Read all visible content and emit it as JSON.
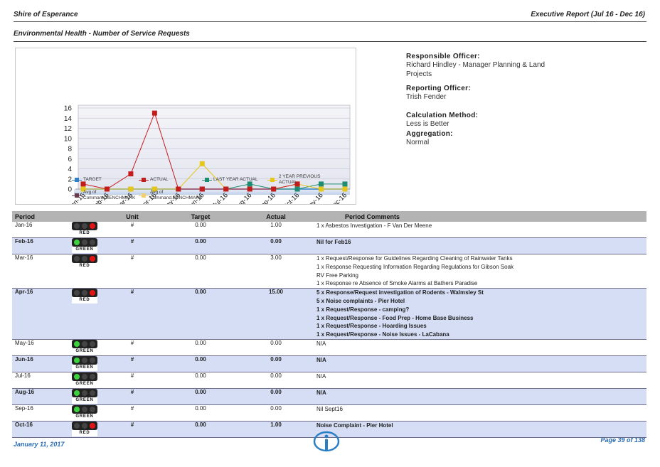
{
  "header": {
    "organisation": "Shire of Esperance",
    "report": "Executive Report (Jul 16 - Dec 16)",
    "subtitle": "Environmental Health - Number of Service Requests"
  },
  "chart_data": {
    "type": "line",
    "categories": [
      "Jan-16",
      "Feb-16",
      "Mar-16",
      "Apr-16",
      "May-16",
      "Jun-16",
      "Jul-16",
      "Aug-16",
      "Sep-16",
      "Oct-16",
      "Nov-16",
      "Dec-16"
    ],
    "ylim": [
      0,
      16
    ],
    "yticks": [
      "0",
      "2",
      "4",
      "6",
      "8",
      "10",
      "12",
      "14",
      "16"
    ],
    "grid": true,
    "legend_position": "bottom",
    "series": [
      {
        "name": "TARGET",
        "color": "#2f7fc9",
        "values": [
          0,
          0,
          0,
          0,
          0,
          0,
          0,
          0,
          0,
          0,
          0,
          0
        ]
      },
      {
        "name": "ACTUAL",
        "color": "#c41b1b",
        "values": [
          1,
          0,
          3,
          15,
          0,
          0,
          0,
          0,
          0,
          1,
          null,
          null
        ]
      },
      {
        "name": "LAST YEAR ACTUAL",
        "color": "#1e8c6e",
        "values": [
          0,
          0,
          0,
          0,
          0,
          0,
          0,
          1,
          0,
          0,
          1,
          1
        ]
      },
      {
        "name": "2 YEAR PREVIOUS ACTUAL",
        "color": "#e6c619",
        "values": [
          0,
          0,
          0,
          0,
          0,
          5,
          0,
          0,
          0,
          1,
          0,
          0
        ]
      },
      {
        "name": "Avg of Command.BENCHMARK",
        "color": "#6b3a4a",
        "values": []
      },
      {
        "name": "Avg of Command.BENCHMARK",
        "color": "#f0d06e",
        "values": []
      }
    ]
  },
  "legend": [
    {
      "label": "TARGET",
      "color": "#2f7fc9"
    },
    {
      "label": "ACTUAL",
      "color": "#c41b1b"
    },
    {
      "label": "LAST YEAR ACTUAL",
      "color": "#1e8c6e"
    },
    {
      "label": "2 YEAR PREVIOUS ACTUAL",
      "color": "#e6c619"
    },
    {
      "label": "Avg of Command.BENCHMARK",
      "color": "#6b3a4a"
    },
    {
      "label": "Avg of Command.BENCHMARK",
      "color": "#f0d06e"
    }
  ],
  "info": {
    "responsible_label": "Responsible Officer:",
    "responsible_value": "Richard Hindley - Manager Planning & Land Projects",
    "reporting_label": "Reporting Officer:",
    "reporting_value": "Trish Fender",
    "calc_label": "Calculation Method:",
    "calc_value": "Less is Better",
    "agg_label": "Aggregation:",
    "agg_value": "Normal"
  },
  "table": {
    "headers": {
      "period": "Period",
      "unit": "Unit",
      "target": "Target",
      "actual": "Actual",
      "comments": "Period Comments"
    },
    "rows": [
      {
        "period": "Jan-16",
        "status": "RED",
        "unit": "#",
        "target": "0.00",
        "actual": "1.00",
        "comments": [
          "1 x Asbestos Investigation - F Van Der Meene"
        ]
      },
      {
        "period": "Feb-16",
        "status": "GREEN",
        "unit": "#",
        "target": "0.00",
        "actual": "0.00",
        "comments": [
          "Nil for Feb16"
        ]
      },
      {
        "period": "Mar-16",
        "status": "RED",
        "unit": "#",
        "target": "0.00",
        "actual": "3.00",
        "comments": [
          "1 x Request/Response for Guidelines Regarding Cleaning of Rainwater Tanks",
          "1 x Response Requesting Information Regarding Regulations for Gibson Soak",
          "RV Free Parking",
          "1 x Response re Absence of Smoke Alarms at Bathers Paradise"
        ]
      },
      {
        "period": "Apr-16",
        "status": "RED",
        "unit": "#",
        "target": "0.00",
        "actual": "15.00",
        "comments": [
          "5 x Response/Request investigation of Rodents - Walmsley St",
          "5 x Noise complaints - Pier Hotel",
          "1 x Request/Response - camping?",
          "1 x Request/Response - Food Prep - Home Base Business",
          "1 x Request/Response - Hoarding Issues",
          "1 x Request/Response - Noise Issues - LaCabana"
        ]
      },
      {
        "period": "May-16",
        "status": "GREEN",
        "unit": "#",
        "target": "0.00",
        "actual": "0.00",
        "comments": [
          "N/A"
        ]
      },
      {
        "period": "Jun-16",
        "status": "GREEN",
        "unit": "#",
        "target": "0.00",
        "actual": "0.00",
        "comments": [
          "N/A"
        ]
      },
      {
        "period": "Jul-16",
        "status": "GREEN",
        "unit": "#",
        "target": "0.00",
        "actual": "0.00",
        "comments": [
          "N/A"
        ]
      },
      {
        "period": "Aug-16",
        "status": "GREEN",
        "unit": "#",
        "target": "0.00",
        "actual": "0.00",
        "comments": [
          "N/A"
        ]
      },
      {
        "period": "Sep-16",
        "status": "GREEN",
        "unit": "#",
        "target": "0.00",
        "actual": "0.00",
        "comments": [
          "Nil Sept16"
        ]
      },
      {
        "period": "Oct-16",
        "status": "RED",
        "unit": "#",
        "target": "0.00",
        "actual": "1.00",
        "comments": [
          "Noise Complaint - Pier Hotel"
        ]
      }
    ]
  },
  "footer": {
    "date": "January 11, 2017",
    "page": "Page 39 of 138"
  }
}
